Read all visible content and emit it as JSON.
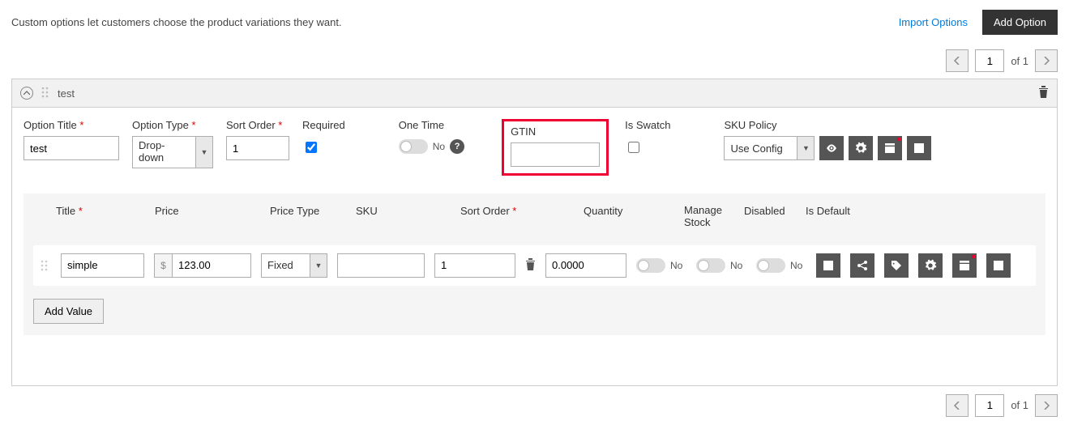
{
  "top": {
    "desc": "Custom options let customers choose the product variations they want.",
    "import": "Import Options",
    "add": "Add Option"
  },
  "pager": {
    "page": "1",
    "of": "of 1"
  },
  "option": {
    "name": "test",
    "labels": {
      "title": "Option Title",
      "type": "Option Type",
      "sort": "Sort Order",
      "required": "Required",
      "onetime": "One Time",
      "gtin": "GTIN",
      "swatch": "Is Swatch",
      "skupolicy": "SKU Policy"
    },
    "title_value": "test",
    "type_value": "Drop-down",
    "sort_value": "1",
    "onetime_no": "No",
    "skupolicy_value": "Use Config",
    "gtin_value": ""
  },
  "values": {
    "headers": {
      "title": "Title",
      "price": "Price",
      "ptype": "Price Type",
      "sku": "SKU",
      "sort": "Sort Order",
      "qty": "Quantity",
      "mstock": "Manage Stock",
      "disabled": "Disabled",
      "isdefault": "Is Default"
    },
    "row": {
      "title": "simple",
      "currency": "$",
      "price": "123.00",
      "ptype": "Fixed",
      "sku": "",
      "sort": "1",
      "qty": "0.0000",
      "no": "No"
    },
    "add": "Add Value"
  }
}
